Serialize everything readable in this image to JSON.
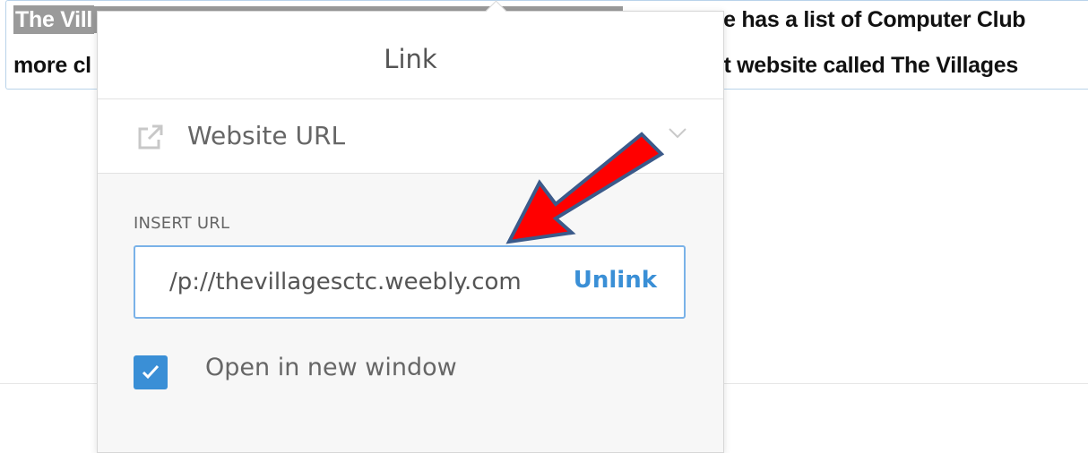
{
  "editor": {
    "line1_start": "The Vill",
    "line1_end": "te has a list of Computer Club",
    "line2_start": "more cl",
    "line2_end": "at website called The Villages"
  },
  "link_popover": {
    "title": "Link",
    "link_type": {
      "icon": "external-link-icon",
      "label": "Website URL",
      "chevron": "chevron-down-icon"
    },
    "insert_url_label": "INSERT URL",
    "url_value": "p://thevillagesctc.weebly.com/",
    "unlink_label": "Unlink",
    "open_new_window": {
      "label": "Open in new window",
      "checked": true
    }
  },
  "colors": {
    "accent": "#3a8fd6",
    "arrow": "#ff0000",
    "arrow_outline": "#3b5a8a"
  }
}
